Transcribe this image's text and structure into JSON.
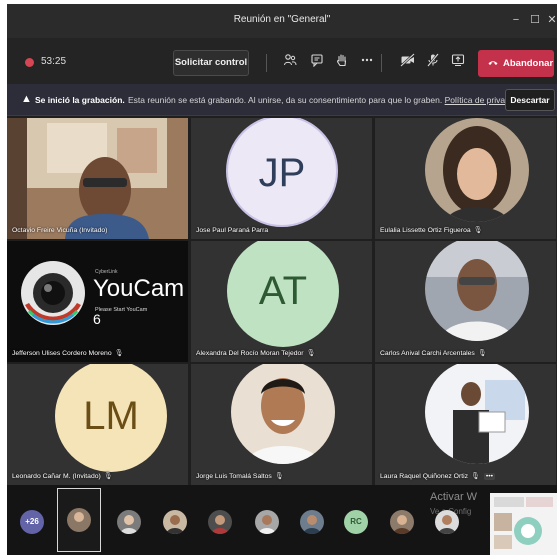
{
  "window": {
    "title": "Reunión en \"General\"",
    "minimize_glyph": "−",
    "maximize_glyph": "☐",
    "close_glyph": "✕"
  },
  "toolbar": {
    "timer": "53:25",
    "request_control_label": "Solicitar control",
    "leave_label": "Abandonar",
    "icons": [
      "participants-icon",
      "chat-icon",
      "raise-hand-icon",
      "more-options-icon",
      "camera-off-icon",
      "mic-off-icon",
      "share-screen-icon",
      "phone-icon"
    ]
  },
  "banner": {
    "title": "Se inició la grabación.",
    "message": "Esta reunión se está grabando. Al unirse, da su consentimiento para que lo graben.",
    "privacy_link": "Política de privacidad",
    "dismiss_label": "Descartar"
  },
  "participants": [
    {
      "name": "Octavio Freire Vicuña (Invitado)",
      "type": "video"
    },
    {
      "name": "Jose Paul Paraná Parra",
      "type": "initials",
      "initials": "JP"
    },
    {
      "name": "Eulalia Lissette Ortiz Figueroa",
      "type": "photo"
    },
    {
      "name": "Jefferson Ulises Cordero Moreno",
      "type": "youcam",
      "youcam_brand": "CyberLink",
      "youcam_title": "YouCam",
      "youcam_version": "6",
      "youcam_sub": "Please Start YouCam"
    },
    {
      "name": "Alexandra Del Rocío Moran Tejedor",
      "type": "initials",
      "initials": "AT"
    },
    {
      "name": "Carlos Anival Carchi Arcentales",
      "type": "photo"
    },
    {
      "name": "Leonardo Cañar M. (Invitado)",
      "type": "initials",
      "initials": "LM"
    },
    {
      "name": "Jorge Luis Tomalá Saltos",
      "type": "photo"
    },
    {
      "name": "Laura Raquel Quiñonez Ortiz",
      "type": "photo"
    }
  ],
  "strip": {
    "more_count": "+26",
    "rc_initials": "RC",
    "watermark_line1": "Activar W",
    "watermark_line2": "Ve a Config"
  },
  "colors": {
    "leave_button": "#c4314b",
    "teams_purple": "#6264a7",
    "jp_bg": "#ece8f5",
    "jp_text": "#2f3e5a",
    "at_bg": "#bfe2c2",
    "at_text": "#2d5a33",
    "lm_bg": "#f5e4b8",
    "lm_text": "#6b4d16"
  }
}
